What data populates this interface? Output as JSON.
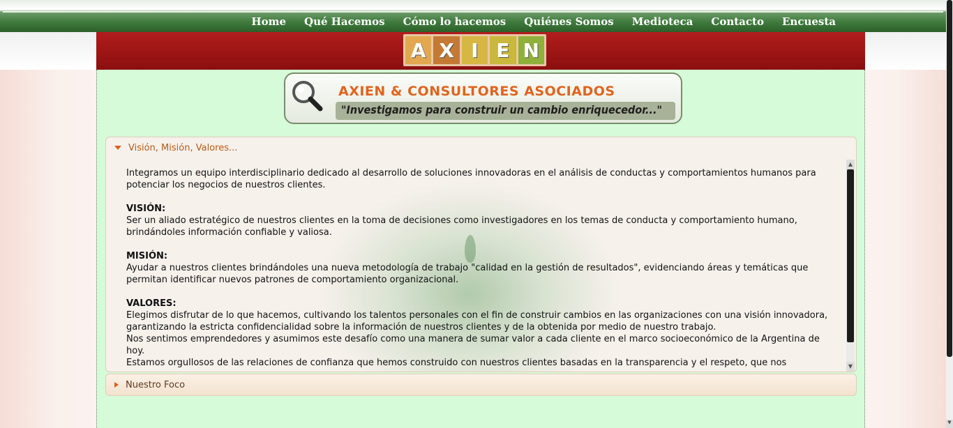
{
  "nav": {
    "items": [
      "Home",
      "Qué Hacemos",
      "Cómo lo hacemos",
      "Quiénes Somos",
      "Medioteca",
      "Contacto",
      "Encuesta"
    ]
  },
  "logo": {
    "letters": [
      "A",
      "X",
      "I",
      "E",
      "N"
    ]
  },
  "banner": {
    "title": "AXIEN & CONSULTORES ASOCIADOS",
    "slogan": "\"Investigamos para construir un cambio enriquecedor...\""
  },
  "accordion": {
    "open_section": {
      "title": "Visión, Misión, Valores...",
      "intro": "Integramos un equipo interdisciplinario dedicado al desarrollo de soluciones innovadoras en el análisis de conductas y comportamientos humanos para potenciar los negocios de nuestros clientes.",
      "vision_label": "VISIÓN:",
      "vision_text": "Ser un aliado estratégico de nuestros clientes en la toma de decisiones como investigadores en los temas de conducta y comportamiento humano, brindándoles información confiable y valiosa.",
      "mision_label": "MISIÓN:",
      "mision_text": "Ayudar a nuestros clientes brindándoles una nueva metodología de trabajo \"calidad en la gestión de resultados\", evidenciando áreas y temáticas que permitan identificar nuevos patrones de comportamiento organizacional.",
      "valores_label": "VALORES:",
      "valores_text_1": "Elegimos disfrutar de lo que hacemos, cultivando los talentos personales con el fin de construir cambios en las organizaciones con una visión innovadora, garantizando la estricta confidencialidad sobre la información de nuestros clientes y de la obtenida por medio de nuestro trabajo.",
      "valores_text_2": "Nos sentimos emprendedores y asumimos este desafío como una manera de sumar valor a cada cliente en el marco socioeconómico de la Argentina de hoy.",
      "valores_text_3": "Estamos orgullosos de las relaciones de confianza que hemos construido con nuestros clientes basadas en la transparencia y el respeto, que nos"
    },
    "closed_section": {
      "title": "Nuestro Foco"
    }
  },
  "colors": {
    "nav_green": "#3e7a3b",
    "header_red": "#9b1414",
    "content_bg": "#d6fbd8",
    "accent_orange": "#d9621a"
  },
  "icons": {
    "banner": "magnifier-icon",
    "open_caret": "caret-down-icon",
    "closed_caret": "caret-right-icon"
  }
}
